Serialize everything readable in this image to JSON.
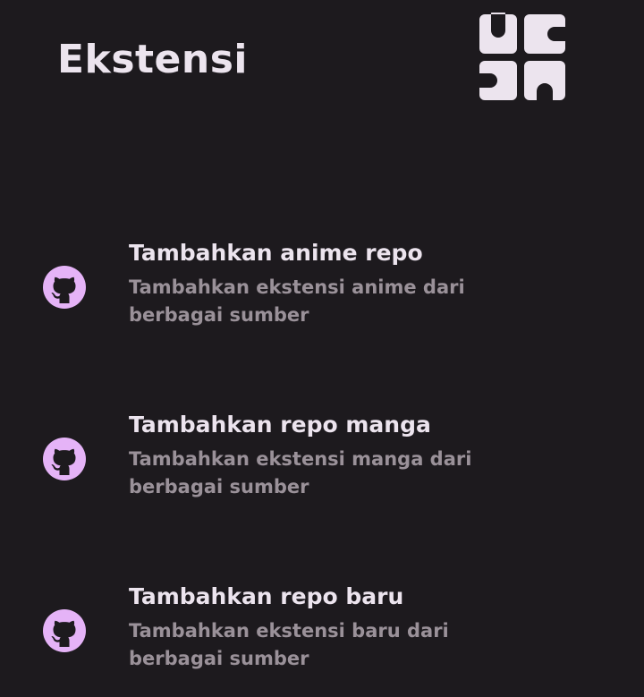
{
  "header": {
    "title": "Ekstensi",
    "icon": "extension-puzzle-icon",
    "icon_color": "#ece4ee"
  },
  "colors": {
    "background": "#1d1a1e",
    "accent": "#e5b3f7",
    "title_text": "#ece4ee",
    "secondary_text": "#9a9199"
  },
  "items": [
    {
      "title": "Tambahkan anime repo",
      "description": "Tambahkan ekstensi anime dari berbagai sumber",
      "icon": "github-icon"
    },
    {
      "title": "Tambahkan repo manga",
      "description": "Tambahkan ekstensi manga dari berbagai sumber",
      "icon": "github-icon"
    },
    {
      "title": "Tambahkan repo baru",
      "description": "Tambahkan ekstensi baru dari berbagai sumber",
      "icon": "github-icon"
    }
  ]
}
